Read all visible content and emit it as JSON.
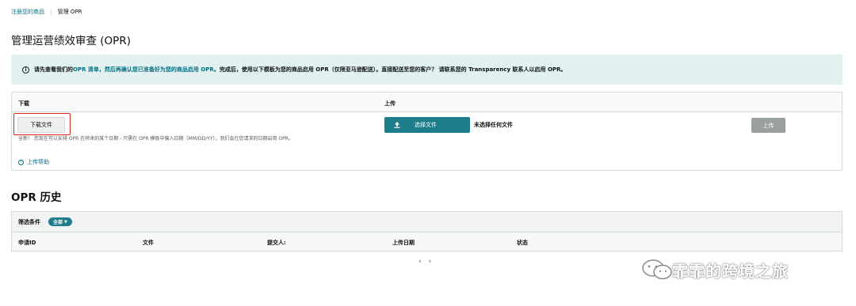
{
  "breadcrumb": {
    "parent": "注册您的商品",
    "current": "管理 OPR"
  },
  "page_title": "管理运营绩效审查 (OPR)",
  "banner": {
    "icon": "info-icon",
    "part1": "请先查看我们的 ",
    "link": "OPR 清单，然后再确认您已准备好为您的商品启用 OPR。",
    "part2": " 完成后，使用以下模板为您的商品启用 OPR（仅限亚马逊配送）。直接配送至您的客户？ 请联系您的 Transparency 联系人以启用 OPR。"
  },
  "download_section": {
    "header": "下载",
    "button_label": "下载文件",
    "helper_text": "全新！ 您现在可以安排 OPR 在将来的某个日期 - 只需在 OPR 模板中输入日期（MM/DD/YY），我们会在您请求的日期启用 OPR。",
    "help_link": "上传帮助"
  },
  "upload_section": {
    "header": "上传",
    "choose_button_label": "选择文件",
    "no_file_text": "未选择任何文件",
    "upload_button_label": "上传"
  },
  "history": {
    "title": "OPR 历史",
    "filter_label": "筛选条件",
    "filter_value": "全部",
    "columns": [
      "申请ID",
      "文件",
      "提交人:",
      "上传日期",
      "状态"
    ]
  },
  "pagination": {
    "prev": "‹",
    "next": "›"
  },
  "watermark": {
    "text": "霏霏的跨境之旅"
  },
  "colors": {
    "link": "#007185",
    "primary": "#1d7d8a",
    "banner_bg": "#e3f1f1",
    "highlight": "#e1251b",
    "disabled": "#9aa0a0"
  }
}
